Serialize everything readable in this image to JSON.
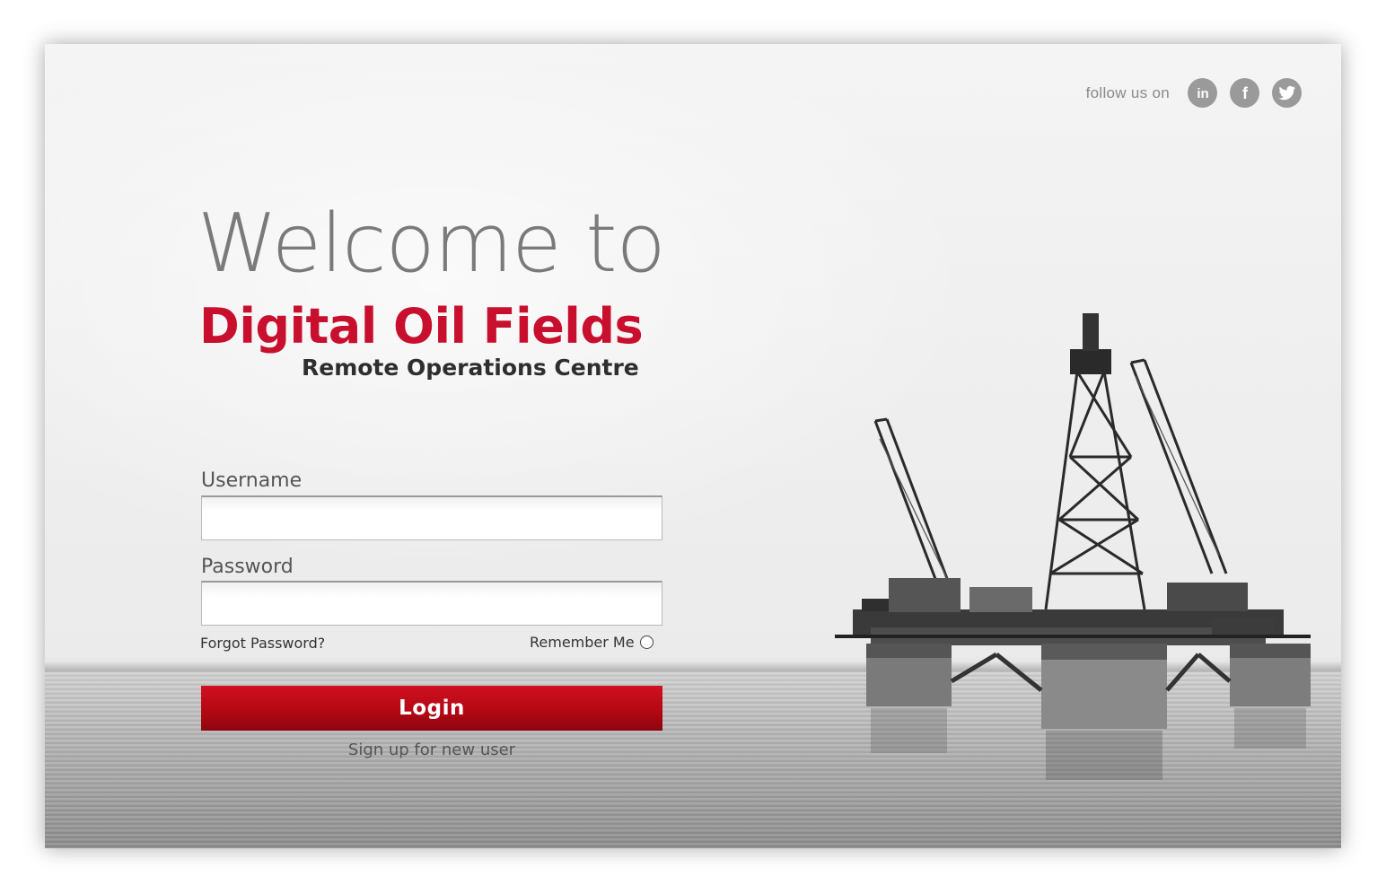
{
  "social": {
    "follow_text": "follow us on",
    "links": [
      {
        "icon": "linkedin-icon",
        "label": "in"
      },
      {
        "icon": "facebook-icon",
        "label": "f"
      },
      {
        "icon": "twitter-icon",
        "label": "twitter"
      }
    ]
  },
  "hero": {
    "welcome": "Welcome to",
    "brand": "Digital Oil Fields",
    "subtitle": "Remote Operations Centre"
  },
  "login_form": {
    "username_label": "Username",
    "username_value": "",
    "password_label": "Password",
    "password_value": "",
    "forgot_link": "Forgot Password?",
    "remember_label": "Remember Me",
    "remember_checked": false,
    "login_button": "Login",
    "signup_link": "Sign up for new user"
  },
  "colors": {
    "brand_red": "#c8102e",
    "button_red": "#b50814",
    "text_gray": "#7a7a7a",
    "icon_gray": "#9a9a9a"
  }
}
